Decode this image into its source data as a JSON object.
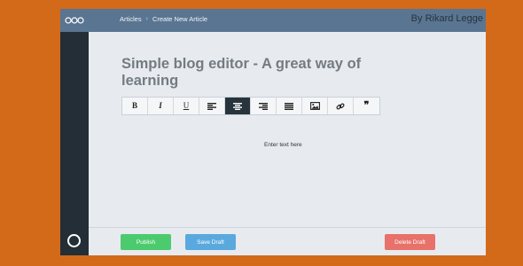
{
  "header": {
    "breadcrumbs": [
      "Articles",
      "Create New Article"
    ],
    "author": "By Rikard Legge"
  },
  "editor": {
    "title": "Simple blog editor - A great way of learning",
    "placeholder": "Enter text here",
    "toolbar": [
      {
        "name": "bold",
        "label": "B",
        "active": false
      },
      {
        "name": "italic",
        "label": "I",
        "active": false
      },
      {
        "name": "underline",
        "label": "U",
        "active": false
      },
      {
        "name": "align-left",
        "label": "",
        "active": false
      },
      {
        "name": "align-center",
        "label": "",
        "active": true
      },
      {
        "name": "align-right",
        "label": "",
        "active": false
      },
      {
        "name": "justify",
        "label": "",
        "active": false
      },
      {
        "name": "image",
        "label": "",
        "active": false
      },
      {
        "name": "link",
        "label": "",
        "active": false
      },
      {
        "name": "quote",
        "label": "❞",
        "active": false
      }
    ]
  },
  "footer": {
    "publish_label": "Publish",
    "save_label": "Save Draft",
    "delete_label": "Delete Draft"
  },
  "colors": {
    "page_background": "#d36a1a",
    "header": "#5a7591",
    "sidebar": "#232e36",
    "publish": "#4ccb6e",
    "save": "#5aa9de",
    "delete": "#e8716a"
  },
  "icons": {
    "logo": "three-circles-icon",
    "sidebar_bottom": "circle-icon"
  }
}
